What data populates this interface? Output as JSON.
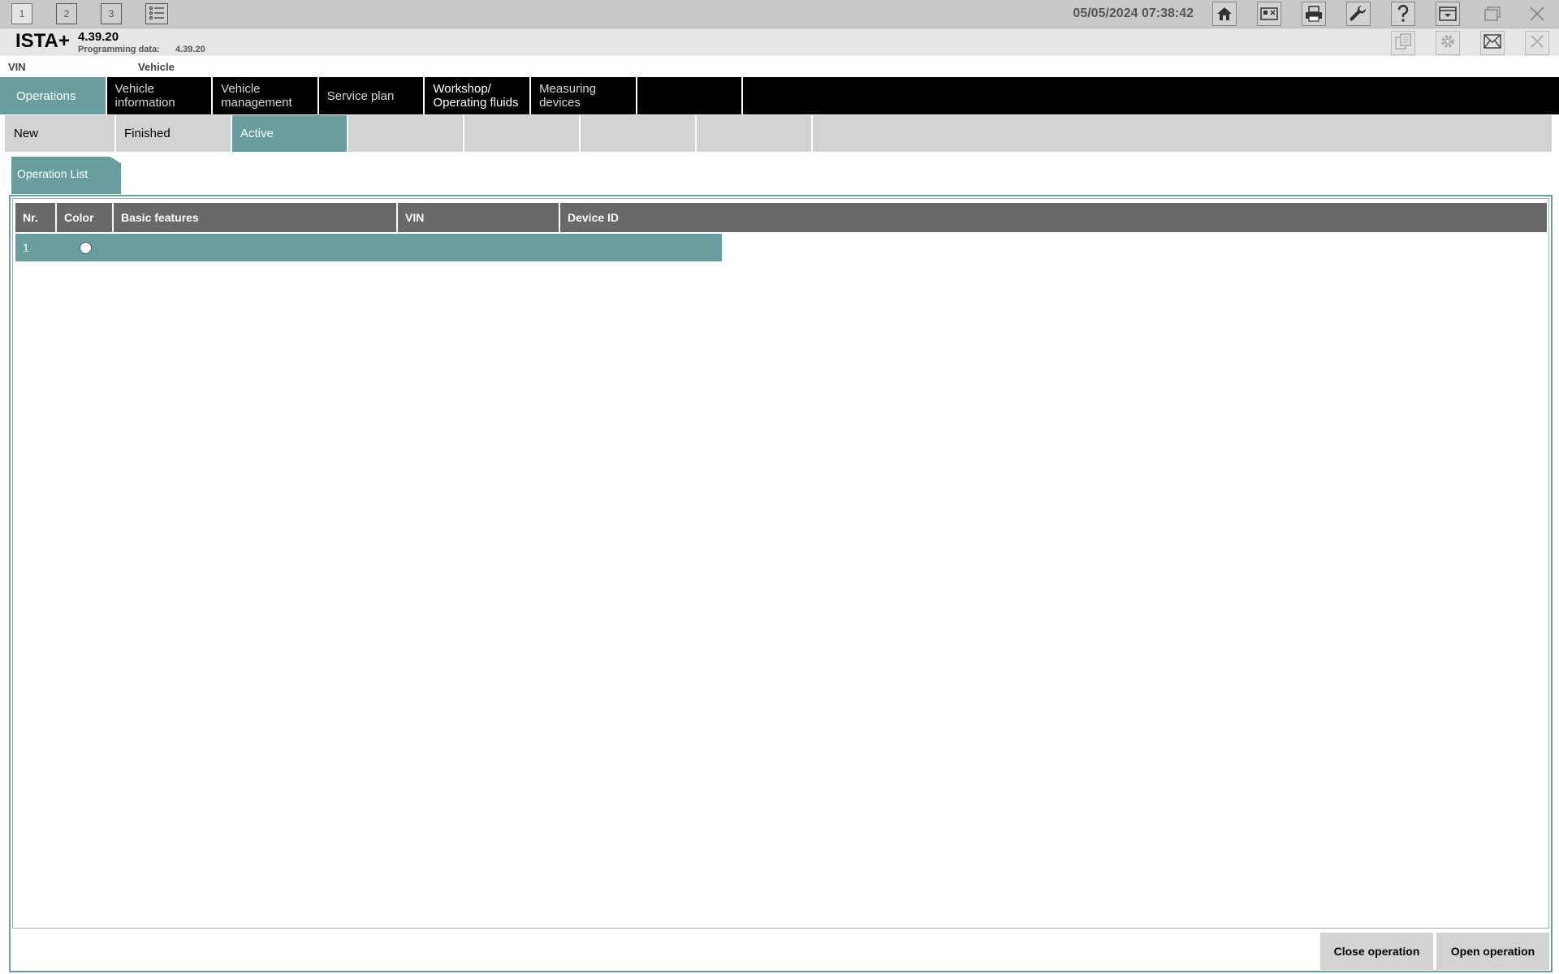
{
  "topbar": {
    "workspaces": [
      "1",
      "2",
      "3"
    ],
    "datetime": "05/05/2024 07:38:42"
  },
  "header": {
    "app_name": "ISTA+",
    "version": "4.39.20",
    "programming_label": "Programming data:",
    "programming_value": "4.39.20"
  },
  "vinrow": {
    "vin_label": "VIN",
    "vehicle_label": "Vehicle"
  },
  "main_tabs": [
    "Operations",
    "Vehicle information",
    "Vehicle management",
    "Service plan",
    "Workshop/ Operating fluids",
    "Measuring devices"
  ],
  "sub_tabs": [
    "New",
    "Finished",
    "Active"
  ],
  "operation_list": {
    "tab_label": "Operation List",
    "columns": [
      "Nr.",
      "Color",
      "Basic features",
      "VIN",
      "Device ID"
    ],
    "rows": [
      {
        "nr": "1"
      }
    ]
  },
  "buttons": {
    "close_operation": "Close operation",
    "open_operation": "Open operation"
  },
  "colors": {
    "accent": "#6a9e9e",
    "header_dark": "#696969",
    "tab_bar": "#000000"
  }
}
